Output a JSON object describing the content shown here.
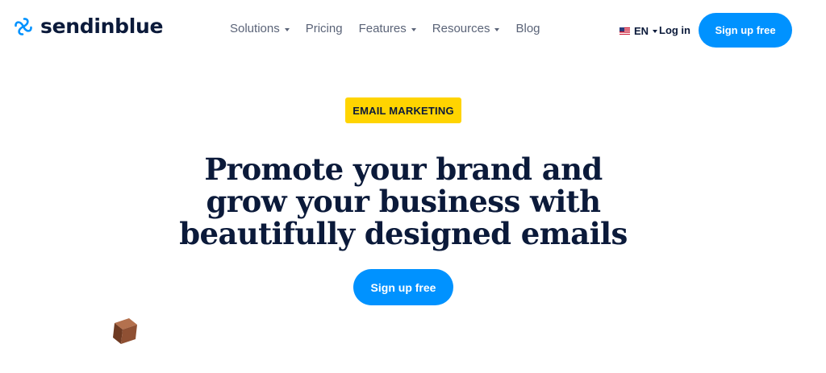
{
  "brand": {
    "name": "sendinblue",
    "logo_icon": "sendinblue-logo-icon",
    "color": "#0092ff"
  },
  "nav": {
    "items": [
      {
        "label": "Solutions",
        "has_dropdown": true
      },
      {
        "label": "Pricing",
        "has_dropdown": false
      },
      {
        "label": "Features",
        "has_dropdown": true
      },
      {
        "label": "Resources",
        "has_dropdown": true
      },
      {
        "label": "Blog",
        "has_dropdown": false
      }
    ]
  },
  "header": {
    "language": {
      "code": "EN",
      "flag_icon": "us-flag-icon"
    },
    "login_label": "Log in",
    "signup_label": "Sign up free"
  },
  "hero": {
    "badge": "EMAIL MARKETING",
    "headline_lines": [
      "Promote your brand and",
      "grow your business with",
      "beautifully designed emails"
    ],
    "cta_label": "Sign up free",
    "decoration_icon": "wooden-cube-icon"
  },
  "colors": {
    "accent": "#0092ff",
    "badge_bg": "#ffd400",
    "headline": "#0b1a3a",
    "nav_text": "#5b6478"
  }
}
